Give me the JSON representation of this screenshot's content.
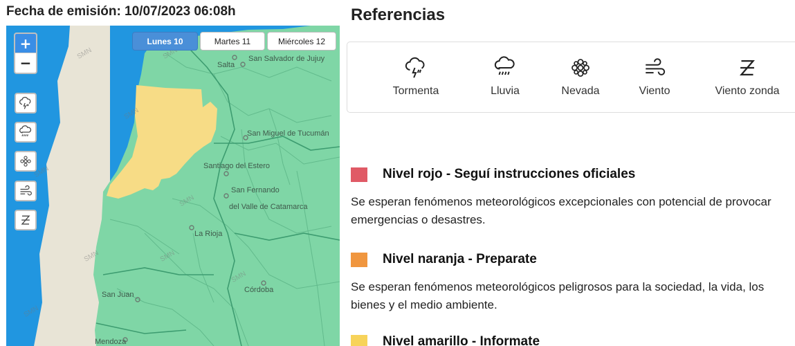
{
  "header": {
    "emission": "Fecha de emisión: 10/07/2023 06:08h"
  },
  "map": {
    "day_tabs": [
      {
        "label": "Lunes 10",
        "active": true
      },
      {
        "label": "Martes 11",
        "active": false
      },
      {
        "label": "Miércoles 12",
        "active": false
      }
    ],
    "zoom": {
      "in": "+",
      "out": "−"
    },
    "phenomenon_buttons": [
      "storm-icon",
      "rain-icon",
      "snow-icon",
      "wind-icon",
      "zonda-wind-icon"
    ],
    "watermark": "SMN",
    "places": [
      "Salta",
      "San Salvador de Jujuy",
      "San Miguel de Tucumán",
      "Santiago del Estero",
      "San Fernando",
      "del Valle de Catamarca",
      "La Rioja",
      "San Juan",
      "Córdoba",
      "Mendoza"
    ],
    "colors": {
      "sea": "#2196e0",
      "land_outside": "#e8e4d6",
      "green": "#7fd6a6",
      "yellow": "#f7dc86"
    }
  },
  "references": {
    "title": "Referencias",
    "items": [
      {
        "icon": "storm-icon",
        "label": "Tormenta"
      },
      {
        "icon": "rain-icon",
        "label": "Lluvia"
      },
      {
        "icon": "snow-icon",
        "label": "Nevada"
      },
      {
        "icon": "wind-icon",
        "label": "Viento"
      },
      {
        "icon": "zonda-wind-icon",
        "label": "Viento zonda"
      }
    ]
  },
  "levels": [
    {
      "color": "#e05a66",
      "title": "Nivel rojo - Seguí instrucciones oficiales",
      "description": "Se esperan fenómenos meteorológicos excepcionales con potencial de provocar emergencias o desastres."
    },
    {
      "color": "#f0963f",
      "title": "Nivel naranja - Preparate",
      "description": "Se esperan fenómenos meteorológicos peligrosos para la sociedad, la vida, los bienes y el medio ambiente."
    },
    {
      "color": "#f7d35a",
      "title": "Nivel amarillo - Informate",
      "description": ""
    }
  ]
}
